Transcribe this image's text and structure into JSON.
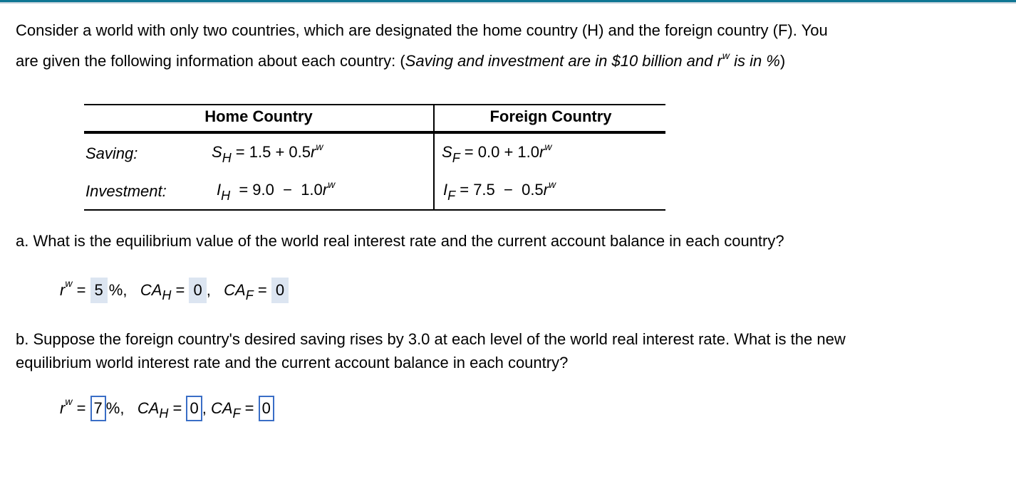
{
  "header": {
    "accent_color": "#0e7693"
  },
  "intro": {
    "line1": "Consider a world with only two countries, which are designated the home country (H) and the foreign country (F). You",
    "line2_prefix": "are given the following information about each country: (",
    "line2_italic": "Saving and investment are in $10 billion and r",
    "line2_sup": "w",
    "line2_italic2": " is in %",
    "line2_suffix": ")"
  },
  "table": {
    "headers": [
      "Home Country",
      "Foreign Country"
    ],
    "rows": [
      {
        "label": "Saving:",
        "home": {
          "var": "S",
          "sub": "H",
          "expr": " = 1.5 + 0.5",
          "r": "r",
          "sup": "w"
        },
        "foreign": {
          "var": "S",
          "sub": "F",
          "expr": " = 0.0 + 1.0",
          "r": "r",
          "sup": "w"
        }
      },
      {
        "label": "Investment:",
        "home": {
          "var": "I",
          "sub": "H",
          "expr": "  = 9.0  −  1.0",
          "r": "r",
          "sup": "w"
        },
        "foreign": {
          "var": "I",
          "sub": "F",
          "expr": " = 7.5  −  0.5",
          "r": "r",
          "sup": "w"
        }
      }
    ]
  },
  "part_a": {
    "question": "a. What is the equilibrium value of the world real interest rate and the current account balance in each country?",
    "rw_value": "5",
    "ca_h_value": "0",
    "ca_f_value": "0"
  },
  "part_b": {
    "question_line1": "b. Suppose the foreign country's desired saving rises by 3.0 at each level of the world real interest rate. What is the new",
    "question_line2": "equilibrium world interest rate and the current account balance in each country?",
    "rw_value": "7",
    "ca_h_value": "0",
    "ca_f_value": "0"
  },
  "symbols": {
    "r": "r",
    "w": "w",
    "eq": " = ",
    "pct": "%,",
    "ca": "CA",
    "H": "H",
    "F": "F",
    "comma": ","
  }
}
